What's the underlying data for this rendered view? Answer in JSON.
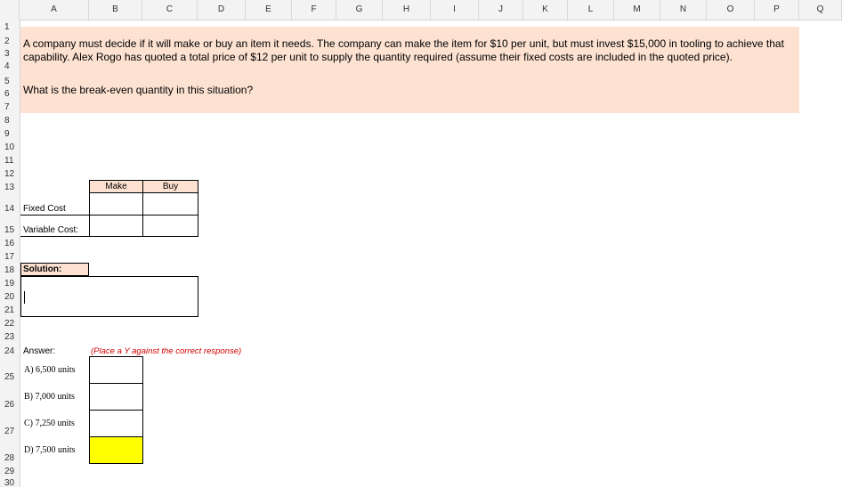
{
  "columns": [
    "A",
    "B",
    "C",
    "D",
    "E",
    "F",
    "G",
    "H",
    "I",
    "J",
    "K",
    "L",
    "M",
    "N",
    "O",
    "P",
    "Q"
  ],
  "rows": [
    "1",
    "2",
    "3",
    "4",
    "5",
    "6",
    "7",
    "8",
    "9",
    "10",
    "11",
    "12",
    "13",
    "14",
    "15",
    "16",
    "17",
    "18",
    "19",
    "20",
    "21",
    "22",
    "23",
    "24",
    "25",
    "26",
    "27",
    "28",
    "29",
    "30"
  ],
  "problem": {
    "line1": "A company must decide if it will make or buy an item it needs. The company can make the item for $10 per unit, but must invest $15,000 in tooling to achieve that",
    "line2": "capability. Alex Rogo has quoted a total price of $12 per unit to supply the quantity required (assume their fixed costs are included in the quoted price).",
    "question": "What is the break-even quantity in this situation?"
  },
  "table": {
    "header_make": "Make",
    "header_buy": "Buy",
    "row_fixed": "Fixed Cost",
    "row_variable": "Variable Cost:",
    "fixed_make": "",
    "fixed_buy": "",
    "variable_make": "",
    "variable_buy": ""
  },
  "solution": {
    "label": "Solution:",
    "value": ""
  },
  "answer": {
    "label": "Answer:",
    "instruction": "(Place a  Y  against the correct response)",
    "options": [
      "A) 6,500 units",
      "B) 7,000 units",
      "C) 7,250 units",
      "D) 7,500 units"
    ],
    "highlight_color": "#ffff00"
  },
  "colors": {
    "peach": "#fde2d2",
    "header_bg": "#f3f3f3",
    "instruction": "#d00000"
  }
}
